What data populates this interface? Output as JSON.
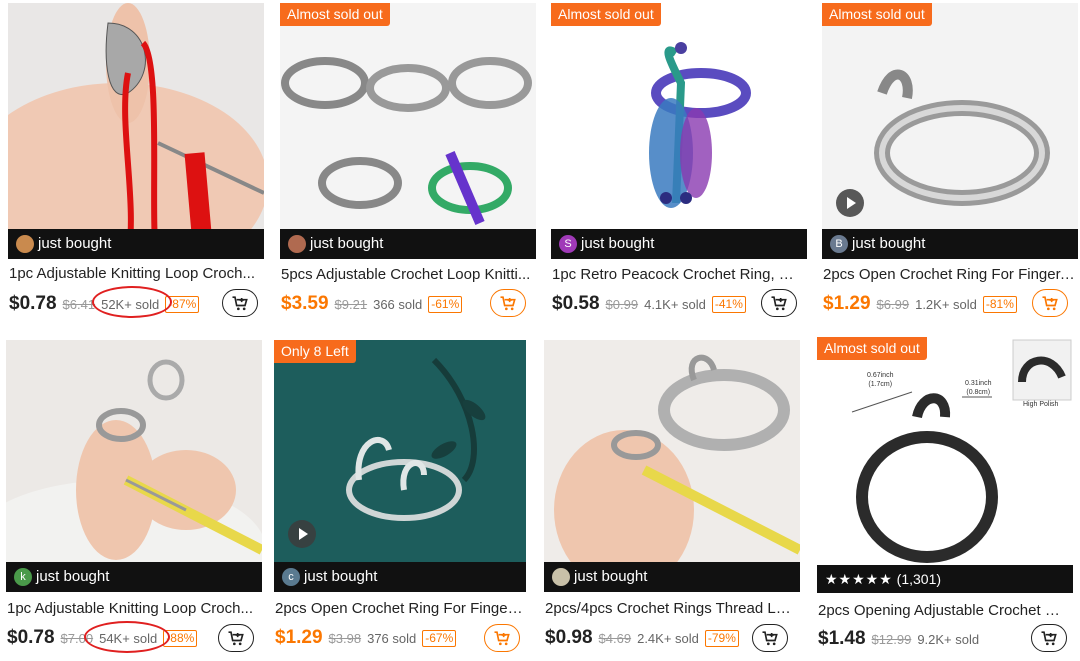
{
  "products": [
    {
      "title": "1pc Adjustable Knitting Loop Croch...",
      "price": "$0.78",
      "old_price": "$6.41",
      "sold": "52K+ sold",
      "discount": "-87%",
      "bought": "just bought",
      "badge": "",
      "avatar_letter": ""
    },
    {
      "title": "5pcs Adjustable Crochet Loop Knitti...",
      "price": "$3.59",
      "old_price": "$9.21",
      "sold": "366 sold",
      "discount": "-61%",
      "bought": "just bought",
      "badge": "Almost sold out",
      "avatar_letter": ""
    },
    {
      "title": "1pc Retro Peacock Crochet Ring, Cro...",
      "price": "$0.58",
      "old_price": "$0.99",
      "sold": "4.1K+ sold",
      "discount": "-41%",
      "bought": "just bought",
      "badge": "Almost sold out",
      "avatar_letter": "S"
    },
    {
      "title": "2pcs Open Crochet Ring For Finger, ...",
      "price": "$1.29",
      "old_price": "$6.99",
      "sold": "1.2K+ sold",
      "discount": "-81%",
      "bought": "just bought",
      "badge": "Almost sold out",
      "avatar_letter": "B"
    },
    {
      "title": "1pc Adjustable Knitting Loop Croch...",
      "price": "$0.78",
      "old_price": "$7.00",
      "sold": "54K+ sold",
      "discount": "-88%",
      "bought": "just bought",
      "badge": "",
      "avatar_letter": "k"
    },
    {
      "title": "2pcs Open Crochet Ring For Finger ...",
      "price": "$1.29",
      "old_price": "$3.98",
      "sold": "376 sold",
      "discount": "-67%",
      "bought": "just bought",
      "badge": "Only 8 Left",
      "avatar_letter": "c"
    },
    {
      "title": "2pcs/4pcs Crochet Rings Thread Lea...",
      "price": "$0.98",
      "old_price": "$4.69",
      "sold": "2.4K+ sold",
      "discount": "-79%",
      "bought": "just bought",
      "badge": "",
      "avatar_letter": ""
    },
    {
      "title": "2pcs Opening Adjustable Crochet W...",
      "price": "$1.48",
      "old_price": "$12.99",
      "sold": "9.2K+ sold",
      "discount": "",
      "bought": "",
      "badge": "Almost sold out",
      "avatar_letter": "",
      "stars": "★★★★★",
      "reviews": "(1,301)"
    }
  ],
  "image_labels": {
    "p8_dim1": "0.67inch",
    "p8_dim1b": "(1.7cm)",
    "p8_dim2": "0.31inch",
    "p8_dim2b": "(0.8cm)",
    "p8_finish": "High Polish"
  },
  "colors": {
    "accent": "#fb7701",
    "badge": "#f76b1c",
    "bar": "#111111",
    "highlight_circle": "#e02020"
  },
  "icons": [
    "add-to-cart-icon",
    "play-icon",
    "star-icon"
  ]
}
